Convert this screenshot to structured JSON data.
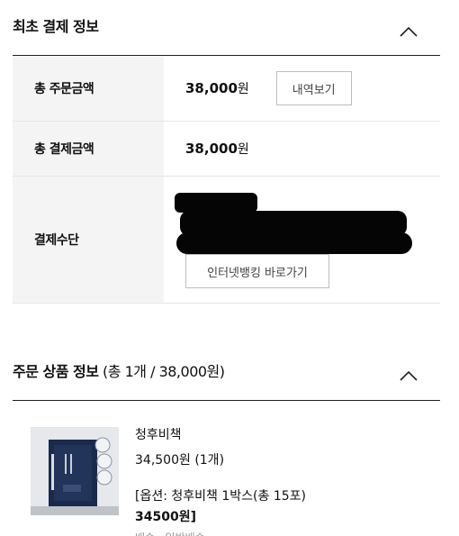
{
  "payment_section": {
    "title": "최초 결제 정보",
    "rows": [
      {
        "label": "총 주문금액",
        "amount": "38,000",
        "unit": "원",
        "button": "내역보기"
      },
      {
        "label": "총 결제금액",
        "amount": "38,000",
        "unit": "원"
      },
      {
        "label": "결제수단",
        "button": "인터넷뱅킹 바로가기"
      }
    ]
  },
  "product_section": {
    "title": "주문 상품 정보",
    "subtitle": " (총 1개 / 38,000원)",
    "item": {
      "name": "청후비책",
      "price": "34,500원 (1개)",
      "option_line1": "[옵션: 청후비책 1박스(총 15포)",
      "option_line2": "34500원]",
      "cut_text": "배송 · 일반배송"
    }
  }
}
